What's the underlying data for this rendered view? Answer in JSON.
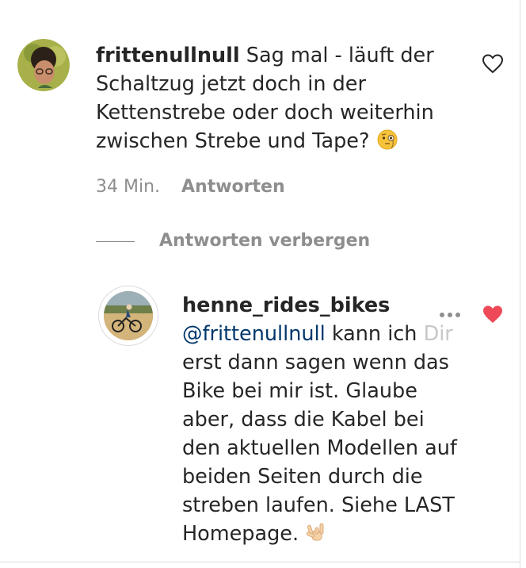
{
  "comment": {
    "username": "frittenullnull",
    "text": "Sag mal - läuft der Schaltzug jetzt doch in der Kettenstrebe oder doch weiterhin zwischen Strebe und Tape?",
    "emoji_icon": "face-with-monocle-icon",
    "time": "34 Min.",
    "reply_label": "Antworten"
  },
  "replies_toggle": {
    "label": "Antworten verbergen"
  },
  "reply": {
    "username": "henne_rides_bikes",
    "mention": "@frittenullnull",
    "text_main": "kann ich",
    "text_faded": "Dir",
    "text_rest": "erst dann sagen wenn das Bike bei mir ist. Glaube aber, dass die Kabel bei den aktuellen Modellen auf beiden Seiten durch die streben laufen. Siehe LAST Homepage.",
    "emoji_icon": "love-you-gesture-icon",
    "liked": true
  },
  "colors": {
    "text": "#262626",
    "secondary": "#8e8e8e",
    "mention": "#00376b",
    "like_red": "#ed4956",
    "divider": "#dbdbdb"
  },
  "icons": {
    "like_outline": "heart-outline-icon",
    "like_filled": "heart-filled-icon",
    "more": "more-options-icon"
  }
}
